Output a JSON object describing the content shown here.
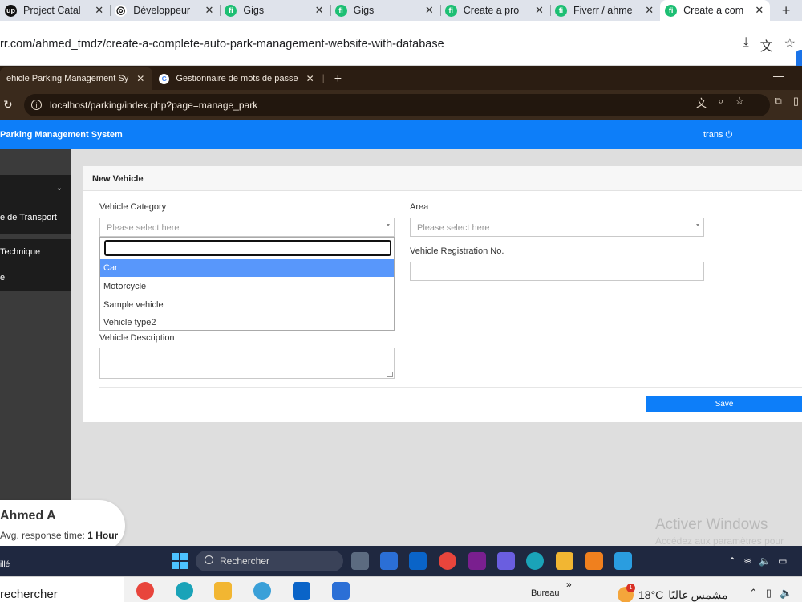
{
  "outer_browser": {
    "tabs": [
      {
        "label": "Project Catal",
        "color": "#111111",
        "glyph": "up"
      },
      {
        "label": "Développeur",
        "color": "#111111",
        "glyph": "◎"
      },
      {
        "label": "Gigs",
        "color": "#1dbf73",
        "glyph": "fi"
      },
      {
        "label": "Gigs",
        "color": "#1dbf73",
        "glyph": "fi"
      },
      {
        "label": "Create a pro",
        "color": "#1dbf73",
        "glyph": "fi"
      },
      {
        "label": "Fiverr / ahme",
        "color": "#1dbf73",
        "glyph": "fi"
      },
      {
        "label": "Create a com",
        "color": "#1dbf73",
        "glyph": "fi"
      }
    ],
    "url": "rr.com/ahmed_tmdz/create-a-complete-auto-park-management-website-with-database"
  },
  "inner_browser": {
    "tabs": [
      {
        "label": "ehicle Parking Management Sy"
      },
      {
        "label": "Gestionnaire de mots de passe"
      }
    ],
    "url": "localhost/parking/index.php?page=manage_park"
  },
  "app": {
    "brand": "Parking Management System",
    "user": "trans"
  },
  "sidebar": {
    "items": [
      "e de Transport",
      "Technique",
      "e"
    ]
  },
  "form": {
    "title": "New Vehicle",
    "vehicle_category_label": "Vehicle Category",
    "vehicle_category_placeholder": "Please select here",
    "area_label": "Area",
    "area_placeholder": "Please select here",
    "registration_label": "Vehicle Registration No.",
    "description_label": "Vehicle Description",
    "save_label": "Save",
    "dropdown_options": [
      "Car",
      "Motorcycle",
      "Sample vehicle",
      "Vehicle type2"
    ],
    "highlighted_option": "Car"
  },
  "watermark": {
    "title": "Activer Windows",
    "subtitle": "Accédez aux paramètres pour"
  },
  "fiverr_card": {
    "name": "Ahmed A",
    "response_prefix": "Avg. response time:",
    "response_value": "1 Hour"
  },
  "inner_taskbar": {
    "left_text": "illé",
    "search_label": "Rechercher"
  },
  "outer_taskbar": {
    "search_label": "rechercher",
    "bureau": "Bureau",
    "temperature": "18°C",
    "weather_text": "مشمس غالبًا",
    "weather_badge": "1"
  },
  "colors": {
    "app_blue": "#0d7ef9",
    "option_highlight": "#5897fb",
    "sidebar_dark": "#1c1c1c"
  }
}
